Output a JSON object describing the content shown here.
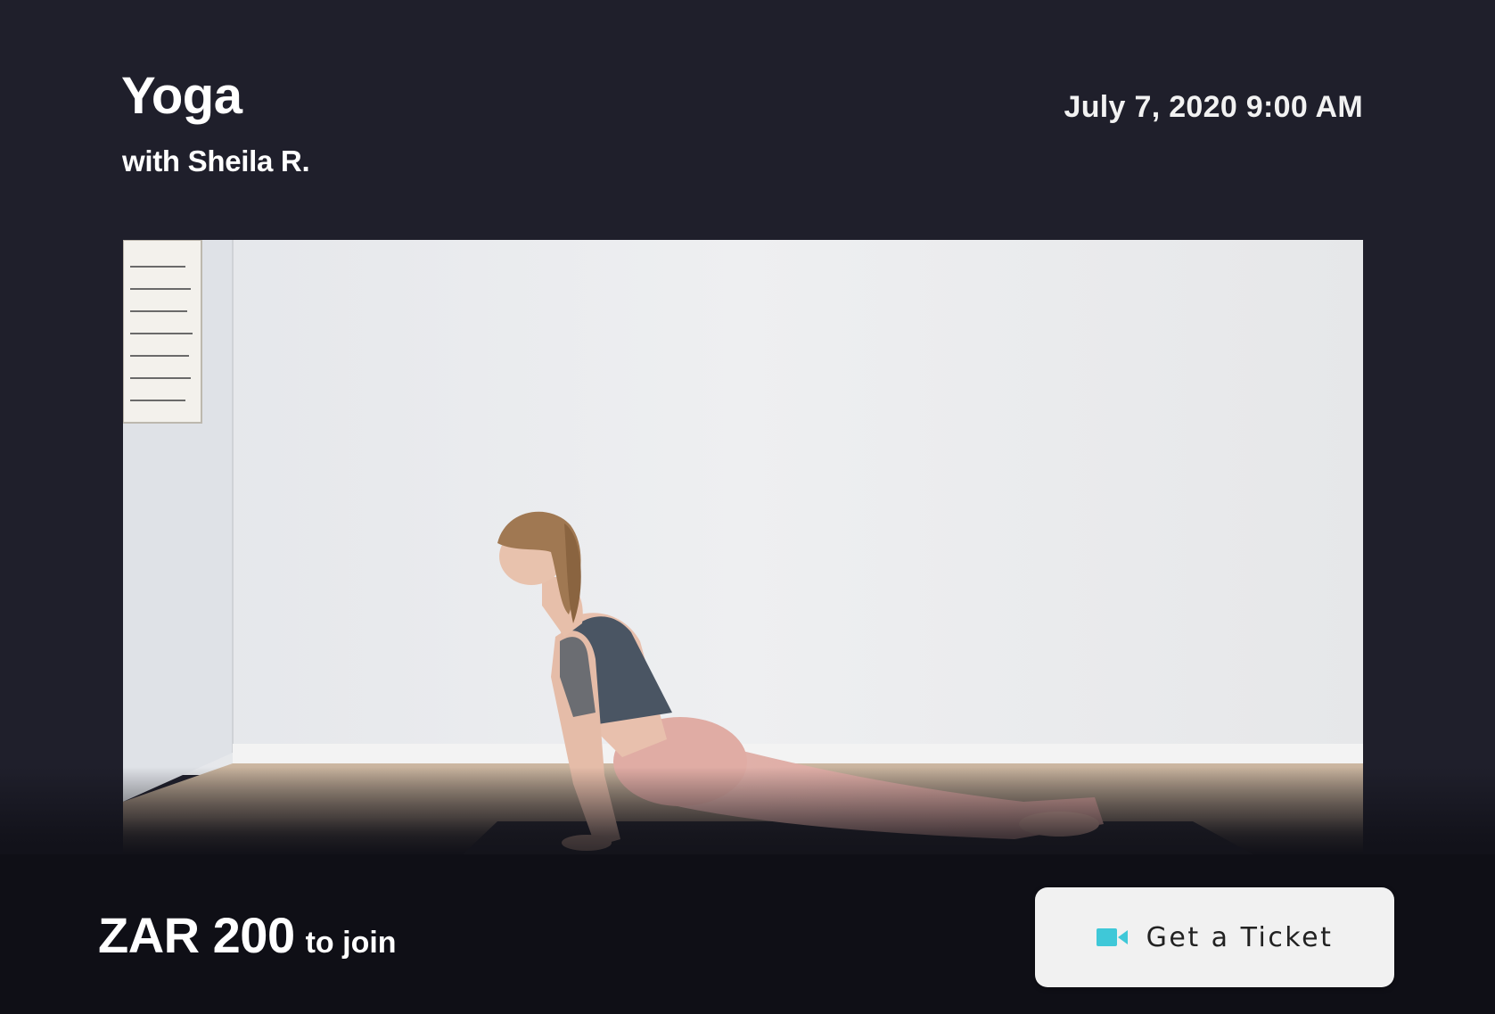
{
  "event": {
    "title": "Yoga",
    "host": "with Sheila R.",
    "datetime": "July 7, 2020 9:00 AM"
  },
  "media": {
    "icon": "yoga-class-image"
  },
  "pricing": {
    "amount": "ZAR 200",
    "suffix": "to join"
  },
  "cta": {
    "label": "Get a Ticket",
    "icon": "video-camera-icon",
    "icon_color": "#3fc8d8"
  },
  "colors": {
    "background": "#1f1f2b",
    "bottom_bar": "#0f0f16",
    "button_bg": "#f1f1f1"
  }
}
